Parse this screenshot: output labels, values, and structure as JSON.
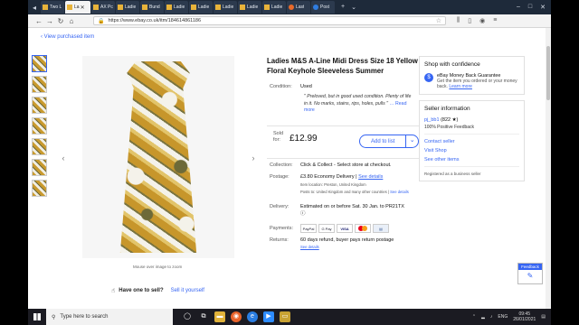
{
  "browser": {
    "tabs": [
      {
        "label": "Two L",
        "icon": "tab-favicon"
      },
      {
        "label": "La",
        "icon": "tab-favicon",
        "active": true
      },
      {
        "label": "AX Pc",
        "icon": "tab-favicon"
      },
      {
        "label": "Ladie",
        "icon": "tab-favicon"
      },
      {
        "label": "Bund",
        "icon": "tab-favicon"
      },
      {
        "label": "Ladie",
        "icon": "tab-favicon"
      },
      {
        "label": "Ladie",
        "icon": "tab-favicon"
      },
      {
        "label": "Ladie",
        "icon": "tab-favicon"
      },
      {
        "label": "Ladie",
        "icon": "tab-favicon"
      },
      {
        "label": "Ladie",
        "icon": "tab-favicon"
      },
      {
        "label": "Last",
        "icon": "firefox-icon"
      },
      {
        "label": "Post",
        "icon": "edge-icon"
      }
    ],
    "url": "https://www.ebay.co.uk/itm/184614861186"
  },
  "page": {
    "view_purchased": "View purchased item",
    "zoom_hint": "Mouse over image to zoom",
    "sell_question": "Have one to sell?",
    "sell_link": "Sell it yourself",
    "title": "Ladies M&S A-Line Midi Dress Size 18 Yellow Floral Keyhole Sleeveless Summer",
    "condition_label": "Condition:",
    "condition_value": "Used",
    "condition_quote": "\" Preloved, but in good used condition. Plenty of life in it. No marks, stains, rips, holes, pulls \"",
    "read_more": "Read more",
    "sold_for_label": "Sold for:",
    "price": "£12.99",
    "add_to_list": "Add to list",
    "collection_label": "Collection:",
    "collection_value": "Click & Collect - Select store at checkout.",
    "postage_label": "Postage:",
    "postage_value": "£3.80",
    "postage_service": "Economy Delivery",
    "see_details": "See details",
    "item_location": "Item location:  Preston, United Kingdom",
    "posts_to": "Posts to:  United Kingdom and many other countries |",
    "delivery_label": "Delivery:",
    "delivery_value": "Estimated on or before Sat. 30 Jan. to PR21TX",
    "payments_label": "Payments:",
    "payments": [
      "PayPal",
      "G Pay",
      "VISA",
      "",
      "Bank"
    ],
    "returns_label": "Returns:",
    "returns_value": "60 days refund, buyer pays return postage"
  },
  "sidebar": {
    "confidence_heading": "Shop with confidence",
    "guarantee_title": "eBay Money Back Guarantee",
    "guarantee_text": "Get the item you ordered or your money back.",
    "learn_more": "Learn more",
    "seller_heading": "Seller information",
    "seller_name": "pj_bb1",
    "seller_score": "(822 ★)",
    "seller_feedback": "100% Positive Feedback",
    "contact_seller": "Contact seller",
    "visit_shop": "Visit Shop",
    "see_other_items": "See other items",
    "business_seller": "Registered as a business seller"
  },
  "feedback_label": "Feedback",
  "taskbar": {
    "search_placeholder": "Type here to search",
    "time": "09:45",
    "date": "26/01/2021",
    "lang": "ENG"
  }
}
